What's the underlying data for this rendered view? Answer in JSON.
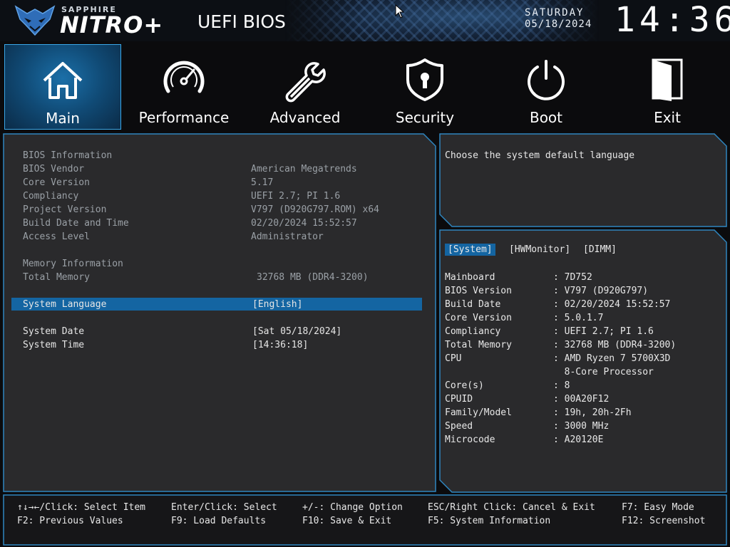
{
  "header": {
    "brand_small": "SAPPHIRE",
    "brand_big": "NITRO+",
    "title": "UEFI BIOS",
    "day": "SATURDAY",
    "date": "05/18/2024",
    "time": "14:36",
    "logo_icon": "sapphire-wolf-logo",
    "cursor_icon": "mouse-pointer-icon"
  },
  "tabs": [
    {
      "label": "Main",
      "icon": "home-icon",
      "active": true
    },
    {
      "label": "Performance",
      "icon": "speedometer-icon",
      "active": false
    },
    {
      "label": "Advanced",
      "icon": "wrench-icon",
      "active": false
    },
    {
      "label": "Security",
      "icon": "shield-lock-icon",
      "active": false
    },
    {
      "label": "Boot",
      "icon": "power-icon",
      "active": false
    },
    {
      "label": "Exit",
      "icon": "door-icon",
      "active": false
    }
  ],
  "main": {
    "bios_info_heading": "BIOS Information",
    "bios_vendor": {
      "label": "BIOS Vendor",
      "value": "American Megatrends"
    },
    "core_version": {
      "label": "Core Version",
      "value": "5.17"
    },
    "compliancy": {
      "label": "Compliancy",
      "value": "UEFI 2.7; PI 1.6"
    },
    "project_version": {
      "label": "Project Version",
      "value": "V797 (D920G797.ROM) x64"
    },
    "build_date": {
      "label": "Build Date and Time",
      "value": "02/20/2024 15:52:57"
    },
    "access_level": {
      "label": "Access Level",
      "value": "Administrator"
    },
    "memory_heading": "Memory Information",
    "total_memory": {
      "label": "Total Memory",
      "value": "32768 MB (DDR4-3200)"
    },
    "system_language": {
      "label": "System Language",
      "value": "[English]"
    },
    "system_date": {
      "label": "System Date",
      "value": "[Sat 05/18/2024]"
    },
    "system_time": {
      "label": "System Time",
      "value": "[14:36:18]"
    }
  },
  "help": {
    "text": "Choose the system default language"
  },
  "info": {
    "tabs": [
      "[System]",
      "[HWMonitor]",
      "[DIMM]"
    ],
    "rows": [
      {
        "label": "Mainboard",
        "value": ": 7D752"
      },
      {
        "label": "BIOS Version",
        "value": ": V797 (D920G797)"
      },
      {
        "label": "Build Date",
        "value": ": 02/20/2024 15:52:57"
      },
      {
        "label": "Core Version",
        "value": ": 5.0.1.7"
      },
      {
        "label": "Compliancy",
        "value": ": UEFI 2.7; PI 1.6"
      },
      {
        "label": "Total Memory",
        "value": ": 32768 MB (DDR4-3200)"
      },
      {
        "label": "CPU",
        "value": ": AMD Ryzen 7 5700X3D"
      },
      {
        "label": "",
        "value": "  8-Core Processor"
      },
      {
        "label": "Core(s)",
        "value": ": 8"
      },
      {
        "label": "CPUID",
        "value": ": 00A20F12"
      },
      {
        "label": "Family/Model",
        "value": ": 19h, 20h-2Fh"
      },
      {
        "label": "Speed",
        "value": ": 3000 MHz"
      },
      {
        "label": "Microcode",
        "value": ": A20120E"
      }
    ]
  },
  "footer": {
    "nav": "↑↓→←/Click: Select Item",
    "enter": "Enter/Click: Select",
    "change": "+/-: Change Option",
    "esc": "ESC/Right Click: Cancel & Exit",
    "f7": "F7: Easy Mode",
    "f2": "F2: Previous Values",
    "f9": "F9: Load Defaults",
    "f10": "F10: Save & Exit",
    "f5": "F5: System Information",
    "f12": "F12: Screenshot"
  },
  "colors": {
    "accent": "#3aa7e8",
    "selection": "#1465a2",
    "frame": "#2f86c0",
    "background": "#0b0b0d"
  }
}
